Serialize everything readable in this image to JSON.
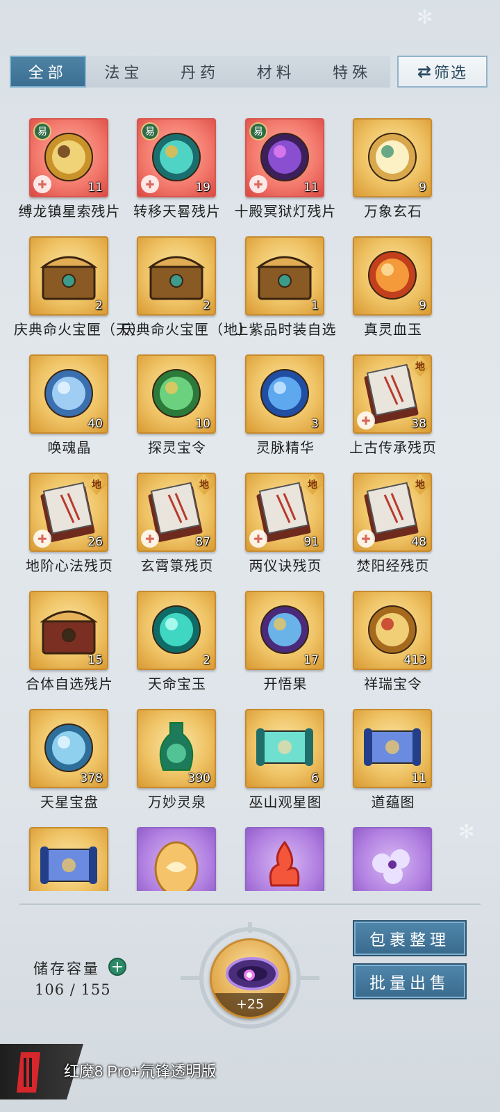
{
  "tabs": [
    {
      "label": "全部",
      "active": true
    },
    {
      "label": "法宝",
      "active": false
    },
    {
      "label": "丹药",
      "active": false
    },
    {
      "label": "材料",
      "active": false
    },
    {
      "label": "特殊",
      "active": false
    }
  ],
  "filter": {
    "label": "筛选",
    "icon": "swap-arrows-icon"
  },
  "items": [
    {
      "name": "缚龙镇星索残片",
      "count": "11",
      "frame": "red",
      "badge": "易",
      "fragment": true,
      "icon": "rope-icon"
    },
    {
      "name": "转移天晷残片",
      "count": "19",
      "frame": "red",
      "badge": "易",
      "fragment": true,
      "icon": "sundial-icon"
    },
    {
      "name": "十殿冥狱灯残片",
      "count": "11",
      "frame": "red",
      "badge": "易",
      "fragment": true,
      "icon": "lotus-lamp-icon"
    },
    {
      "name": "万象玄石",
      "count": "9",
      "frame": "gold",
      "icon": "stone-disc-icon"
    },
    {
      "name": "庆典命火宝匣（天）",
      "count": "2",
      "frame": "gold",
      "icon": "chest-icon"
    },
    {
      "name": "庆典命火宝匣（地）",
      "count": "2",
      "frame": "gold",
      "icon": "chest-icon"
    },
    {
      "name": "上紫品时装自选",
      "count": "1",
      "frame": "gold",
      "icon": "chest-icon"
    },
    {
      "name": "真灵血玉",
      "count": "9",
      "frame": "gold",
      "icon": "orb-red-icon"
    },
    {
      "name": "唤魂晶",
      "count": "40",
      "frame": "gold",
      "icon": "crystal-icon"
    },
    {
      "name": "探灵宝令",
      "count": "10",
      "frame": "gold",
      "icon": "token-green-icon"
    },
    {
      "name": "灵脉精华",
      "count": "3",
      "frame": "gold",
      "icon": "flame-blue-icon"
    },
    {
      "name": "上古传承残页",
      "count": "38",
      "frame": "gold",
      "badge_di": "地",
      "fragment": true,
      "icon": "book-icon"
    },
    {
      "name": "地阶心法残页",
      "count": "26",
      "frame": "gold",
      "badge_di": "地",
      "fragment": true,
      "icon": "book-icon"
    },
    {
      "name": "玄霄箓残页",
      "count": "87",
      "frame": "gold",
      "badge_di": "地",
      "fragment": true,
      "icon": "book-icon"
    },
    {
      "name": "两仪诀残页",
      "count": "91",
      "frame": "gold",
      "badge_di": "地",
      "fragment": true,
      "icon": "book-icon"
    },
    {
      "name": "焚阳经残页",
      "count": "48",
      "frame": "gold",
      "badge_di": "地",
      "fragment": true,
      "icon": "book-icon"
    },
    {
      "name": "合体自选残片",
      "count": "15",
      "frame": "gold",
      "icon": "open-chest-icon"
    },
    {
      "name": "天命宝玉",
      "count": "2",
      "frame": "gold",
      "icon": "orb-teal-icon"
    },
    {
      "name": "开悟果",
      "count": "17",
      "frame": "gold",
      "icon": "fruit-icon"
    },
    {
      "name": "祥瑞宝令",
      "count": "413",
      "frame": "gold",
      "icon": "token-gold-icon"
    },
    {
      "name": "天星宝盘",
      "count": "378",
      "frame": "gold",
      "icon": "star-plate-icon"
    },
    {
      "name": "万妙灵泉",
      "count": "390",
      "frame": "gold",
      "icon": "vase-icon"
    },
    {
      "name": "巫山观星图",
      "count": "6",
      "frame": "gold",
      "icon": "scroll-teal-icon"
    },
    {
      "name": "道蕴图",
      "count": "11",
      "frame": "gold",
      "icon": "scroll-blue-icon"
    },
    {
      "name": "",
      "count": "",
      "frame": "gold",
      "icon": "scroll-blue-icon"
    },
    {
      "name": "",
      "count": "",
      "frame": "purple",
      "icon": "egg-icon"
    },
    {
      "name": "",
      "count": "",
      "frame": "purple",
      "icon": "fire-icon"
    },
    {
      "name": "",
      "count": "",
      "frame": "purple",
      "icon": "flower-icon"
    }
  ],
  "storage": {
    "label": "储存容量",
    "value": "106 / 155"
  },
  "expand_item": {
    "bonus": "+25",
    "icon": "purple-ring-icon"
  },
  "buttons": {
    "organize": "包裹整理",
    "bulk_sell": "批量出售"
  },
  "watermark": {
    "text": "红魔8 Pro+氘锋透明版"
  },
  "colors": {
    "tab_active": "#3b6e90",
    "accent": "#4f86aa",
    "gold_frame": "#efc365",
    "red_frame": "#f2776a",
    "purple_frame": "#b07fe0"
  }
}
